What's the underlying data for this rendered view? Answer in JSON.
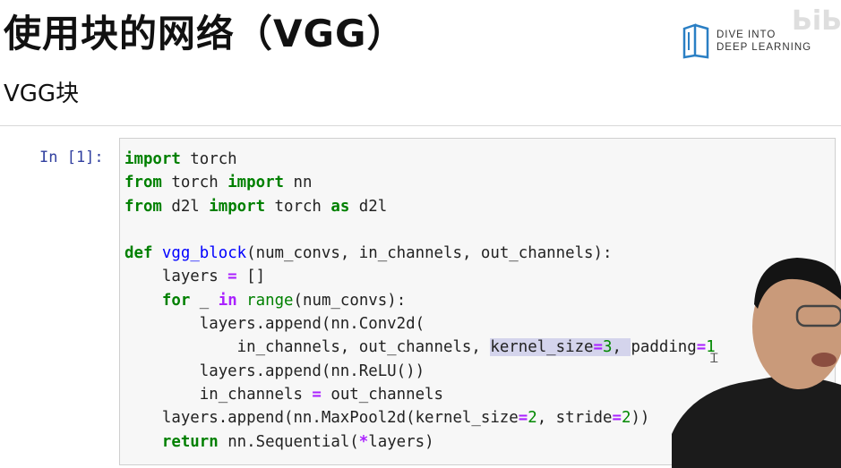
{
  "slide": {
    "title": "使用块的网络（VGG）",
    "subtitle": "VGG块"
  },
  "logo": {
    "line1": "DIVE INTO",
    "line2": "DEEP LEARNING"
  },
  "notebook": {
    "prompt": "In [1]:",
    "code_lines": [
      "import torch",
      "from torch import nn",
      "from d2l import torch as d2l",
      "",
      "def vgg_block(num_convs, in_channels, out_channels):",
      "    layers = []",
      "    for _ in range(num_convs):",
      "        layers.append(nn.Conv2d(",
      "            in_channels, out_channels, kernel_size=3, padding=1",
      "        layers.append(nn.ReLU())",
      "        in_channels = out_channels",
      "    layers.append(nn.MaxPool2d(kernel_size=2, stride=2))",
      "    return nn.Sequential(*layers)"
    ]
  },
  "colors": {
    "keyword": "#008000",
    "function_name": "#0000ff",
    "operator": "#aa22ff",
    "prompt": "#303f9f",
    "selection": "#d4d4ec"
  }
}
